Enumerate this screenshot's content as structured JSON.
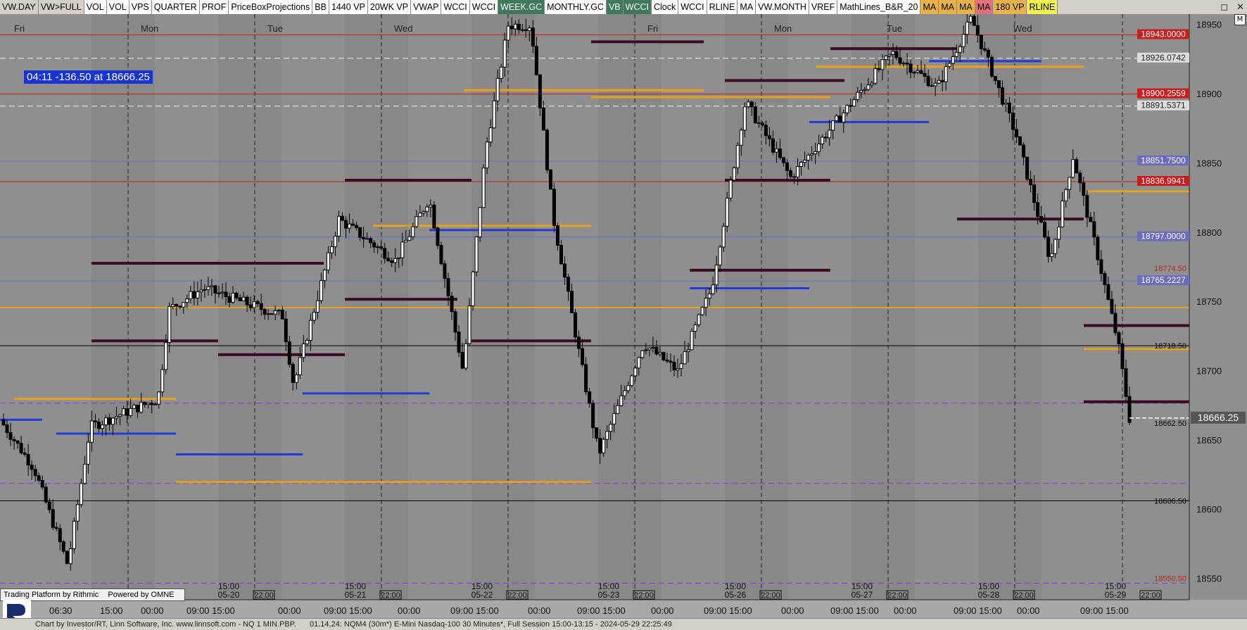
{
  "toolbar": {
    "items": [
      {
        "label": "VW.DAY",
        "bg": "#d4d0c8"
      },
      {
        "label": "VW>FULL",
        "bg": "#d4d0c8"
      },
      {
        "label": "VOL",
        "bg": "#ffffff"
      },
      {
        "label": "VOL",
        "bg": "#ffffff"
      },
      {
        "label": "VPS",
        "bg": "#ffffff"
      },
      {
        "label": "QUARTER",
        "bg": "#ffffff"
      },
      {
        "label": "PROF",
        "bg": "#ffffff"
      },
      {
        "label": "PriceBoxProjections",
        "bg": "#ffffff"
      },
      {
        "label": "BB",
        "bg": "#ffffff"
      },
      {
        "label": "1440 VP",
        "bg": "#ffffff"
      },
      {
        "label": "20WK VP",
        "bg": "#ffffff"
      },
      {
        "label": "VWAP",
        "bg": "#ffffff"
      },
      {
        "label": "WCCI",
        "bg": "#ffffff"
      },
      {
        "label": "WCCI",
        "bg": "#ffffff"
      },
      {
        "label": "WEEK.GC",
        "bg": "#3f7a5b",
        "color": "#ffffff"
      },
      {
        "label": "MONTHLY.GC",
        "bg": "#ffffff"
      },
      {
        "label": "VB",
        "bg": "#3f7a5b",
        "color": "#ffffff"
      },
      {
        "label": "WCCI",
        "bg": "#3f7a5b",
        "color": "#ffffff"
      },
      {
        "label": "Clock",
        "bg": "#ffffff"
      },
      {
        "label": "WCCI",
        "bg": "#ffffff"
      },
      {
        "label": "RLINE",
        "bg": "#ffffff"
      },
      {
        "label": "MA",
        "bg": "#ffffff"
      },
      {
        "label": "VW.MONTH",
        "bg": "#ffffff"
      },
      {
        "label": "VREF",
        "bg": "#ffffff"
      },
      {
        "label": "MathLines_B&R_20",
        "bg": "#ffffff"
      },
      {
        "label": "MA",
        "bg": "#e8b24a"
      },
      {
        "label": "MA",
        "bg": "#e8b24a"
      },
      {
        "label": "MA",
        "bg": "#e8b24a"
      },
      {
        "label": "MA",
        "bg": "#e0707a"
      },
      {
        "label": "180 VP",
        "bg": "#e8b24a"
      },
      {
        "label": "RLINE",
        "bg": "#f0f050"
      }
    ],
    "window_icons": [
      "restore-icon",
      "close-icon"
    ]
  },
  "cursor_readout": "04:11  -136.50 at 18666.25",
  "corner_label": "M",
  "branding": {
    "left": "Trading Platform by Rithmic",
    "right": "Powered by OMNE"
  },
  "status": {
    "left": "Chart by Investor/RT, Linn Software, Inc. www.linnsoft.com - NQ 1 MIN.PBP.",
    "right": "01.14,24: NQM4 (30m*) E-Mini Nasdaq-100 30 Minutes*, Full Session 15:00-13:15 - 2024-05-29 22:25:49"
  },
  "colors": {
    "bg": "#8f8f8f",
    "band_dark": "#848484",
    "candle": "#000000",
    "candle_up_fill": "#ffffff",
    "red_line": "#c81e1e",
    "blue_line": "#1f3bd8",
    "gold_line": "#e5a21a",
    "maroon_line": "#3a0c24",
    "purple_dash": "#7a3cf0",
    "steel_line": "#6c6cbf"
  },
  "chart_data": {
    "type": "candlestick",
    "symbol": "NQM4",
    "timeframe": "30 Minutes",
    "x_day_labels": [
      "Fri",
      "Mon",
      "Tue",
      "Wed",
      "Fri",
      "Mon",
      "Tue",
      "Wed"
    ],
    "session_marks": [
      {
        "time": "15:00",
        "date": "05-20"
      },
      {
        "time": "15:00",
        "date": "05-21"
      },
      {
        "time": "15:00",
        "date": "05-22"
      },
      {
        "time": "15:00",
        "date": "05-23"
      },
      {
        "time": "15:00",
        "date": "05-26"
      },
      {
        "time": "15:00",
        "date": "05-27"
      },
      {
        "time": "15:00",
        "date": "05-28"
      },
      {
        "time": "15:00",
        "date": "05-29"
      }
    ],
    "bottom_tick_labels": [
      "06:30",
      "15:00",
      "00:00",
      "09:00 15:00",
      "00:00",
      "09:00 15:00",
      "00:00",
      "09:00 15:00",
      "00:00",
      "09:00 15:00",
      "00:00",
      "09:00 15:00",
      "00:00",
      "09:00 15:00",
      "00:00",
      "09:00 15:00",
      "00:00",
      "09:00 15:00"
    ],
    "bottom_22_label": "22:00",
    "y_ticks": [
      18550,
      18600,
      18650,
      18700,
      18750,
      18800,
      18850,
      18900,
      18950
    ],
    "y_range": [
      18535,
      18958
    ],
    "last_price": "18666.25",
    "price_labels": [
      {
        "text": "18943.0000",
        "price": 18943.0,
        "style": "box",
        "color": "#c81e1e"
      },
      {
        "text": "18926.0742",
        "price": 18926.07,
        "style": "box",
        "color": "#dddddd"
      },
      {
        "text": "18900.2559",
        "price": 18900.26,
        "style": "box",
        "color": "#c81e1e"
      },
      {
        "text": "18891.5371",
        "price": 18891.54,
        "style": "box",
        "color": "#dddddd"
      },
      {
        "text": "18851.7500",
        "price": 18851.75,
        "style": "box",
        "color": "#6c6cbf"
      },
      {
        "text": "18836.9941",
        "price": 18836.99,
        "style": "box",
        "color": "#c81e1e"
      },
      {
        "text": "18797.0000",
        "price": 18797.0,
        "style": "box",
        "color": "#6c6cbf"
      },
      {
        "text": "18774.50",
        "price": 18774.5,
        "style": "text",
        "color": "#c81e1e"
      },
      {
        "text": "18765.2227",
        "price": 18765.22,
        "style": "box",
        "color": "#6c6cbf"
      },
      {
        "text": "18718.50",
        "price": 18718.5,
        "style": "text",
        "color": "#000000"
      },
      {
        "text": "18662.50",
        "price": 18662.5,
        "style": "text",
        "color": "#000000"
      },
      {
        "text": "18606.50",
        "price": 18606.5,
        "style": "text",
        "color": "#000000"
      },
      {
        "text": "18550.50",
        "price": 18550.5,
        "style": "text",
        "color": "#c81e1e"
      }
    ],
    "horizontal_levels": [
      {
        "price": 18943.0,
        "color": "#c81e1e",
        "style": "solid"
      },
      {
        "price": 18926.07,
        "color": "#f0f0f0",
        "style": "dashed"
      },
      {
        "price": 18900.26,
        "color": "#c81e1e",
        "style": "solid"
      },
      {
        "price": 18891.54,
        "color": "#f0f0f0",
        "style": "dashed"
      },
      {
        "price": 18851.75,
        "color": "#6c6cbf",
        "style": "solid"
      },
      {
        "price": 18836.99,
        "color": "#c81e1e",
        "style": "solid"
      },
      {
        "price": 18797.0,
        "color": "#6c6cbf",
        "style": "solid"
      },
      {
        "price": 18765.22,
        "color": "#6c6cbf",
        "style": "solid"
      },
      {
        "price": 18746.0,
        "color": "#e5a21a",
        "style": "solid"
      },
      {
        "price": 18718.5,
        "color": "#000000",
        "style": "solid"
      },
      {
        "price": 18606.5,
        "color": "#000000",
        "style": "solid"
      },
      {
        "price": 18677.0,
        "color": "#7a3cf0",
        "style": "dashed"
      },
      {
        "price": 18619.0,
        "color": "#7a3cf0",
        "style": "dashed"
      },
      {
        "price": 18547.0,
        "color": "#7a3cf0",
        "style": "dashed"
      }
    ],
    "key_points": [
      {
        "x": 0.0,
        "price": 18665
      },
      {
        "x": 0.03,
        "price": 18630
      },
      {
        "x": 0.06,
        "price": 18560
      },
      {
        "x": 0.08,
        "price": 18660
      },
      {
        "x": 0.14,
        "price": 18680
      },
      {
        "x": 0.15,
        "price": 18745
      },
      {
        "x": 0.18,
        "price": 18760
      },
      {
        "x": 0.25,
        "price": 18740
      },
      {
        "x": 0.26,
        "price": 18690
      },
      {
        "x": 0.3,
        "price": 18810
      },
      {
        "x": 0.35,
        "price": 18780
      },
      {
        "x": 0.38,
        "price": 18825
      },
      {
        "x": 0.41,
        "price": 18700
      },
      {
        "x": 0.43,
        "price": 18860
      },
      {
        "x": 0.45,
        "price": 18950
      },
      {
        "x": 0.47,
        "price": 18950
      },
      {
        "x": 0.49,
        "price": 18810
      },
      {
        "x": 0.53,
        "price": 18640
      },
      {
        "x": 0.57,
        "price": 18720
      },
      {
        "x": 0.6,
        "price": 18700
      },
      {
        "x": 0.63,
        "price": 18760
      },
      {
        "x": 0.66,
        "price": 18895
      },
      {
        "x": 0.7,
        "price": 18840
      },
      {
        "x": 0.74,
        "price": 18880
      },
      {
        "x": 0.79,
        "price": 18930
      },
      {
        "x": 0.83,
        "price": 18905
      },
      {
        "x": 0.86,
        "price": 18955
      },
      {
        "x": 0.9,
        "price": 18870
      },
      {
        "x": 0.93,
        "price": 18780
      },
      {
        "x": 0.95,
        "price": 18855
      },
      {
        "x": 0.97,
        "price": 18790
      },
      {
        "x": 0.99,
        "price": 18720
      },
      {
        "x": 1.0,
        "price": 18666
      }
    ]
  }
}
